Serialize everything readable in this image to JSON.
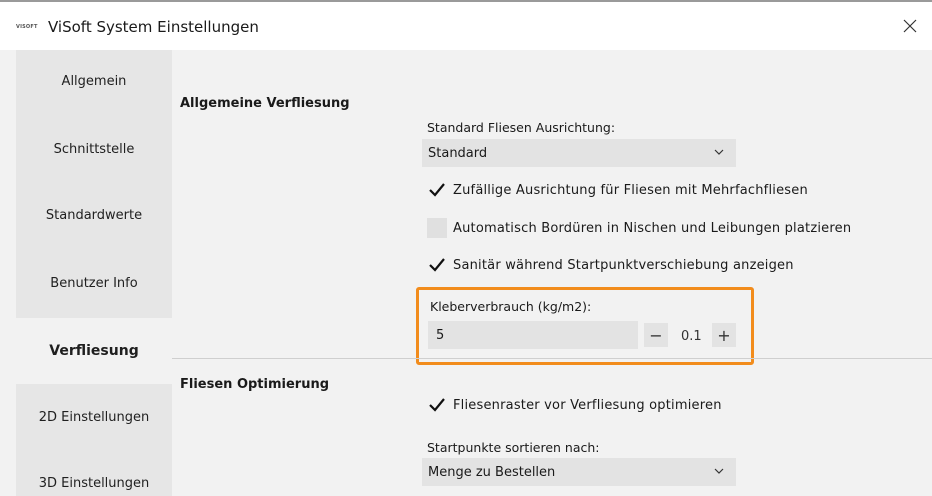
{
  "window": {
    "logo_text": "VISOFT",
    "title": "ViSoft System Einstellungen"
  },
  "sidebar": {
    "items": [
      {
        "label": "Allgemein"
      },
      {
        "label": "Schnittstelle"
      },
      {
        "label": "Standardwerte"
      },
      {
        "label": "Benutzer Info"
      },
      {
        "label": "Verfliesung",
        "active": true
      },
      {
        "label": "2D Einstellungen"
      },
      {
        "label": "3D Einstellungen"
      }
    ]
  },
  "main": {
    "section1_title": "Allgemeine Verfliesung",
    "alignment_label": "Standard Fliesen Ausrichtung:",
    "alignment_value": "Standard",
    "checkbox_random": {
      "label": "Zufällige Ausrichtung für Fliesen mit Mehrfachfliesen",
      "checked": true
    },
    "checkbox_border": {
      "label": "Automatisch Bordüren in Nischen und Leibungen platzieren",
      "checked": false
    },
    "checkbox_sanitary": {
      "label": "Sanitär während Startpunktverschiebung anzeigen",
      "checked": true
    },
    "adhesive_label": "Kleberverbrauch (kg/m2):",
    "adhesive_value": "5",
    "adhesive_step": "0.1",
    "minus_symbol": "−",
    "plus_symbol": "+",
    "section2_title": "Fliesen Optimierung",
    "checkbox_optimize": {
      "label": "Fliesenraster vor Verfliesung optimieren",
      "checked": true
    },
    "sort_label": "Startpunkte sortieren nach:",
    "sort_value": "Menge zu Bestellen"
  },
  "colors": {
    "highlight": "#f28c1c",
    "sidebar_bg": "#e6e6e6",
    "content_bg": "#f2f2f2"
  }
}
